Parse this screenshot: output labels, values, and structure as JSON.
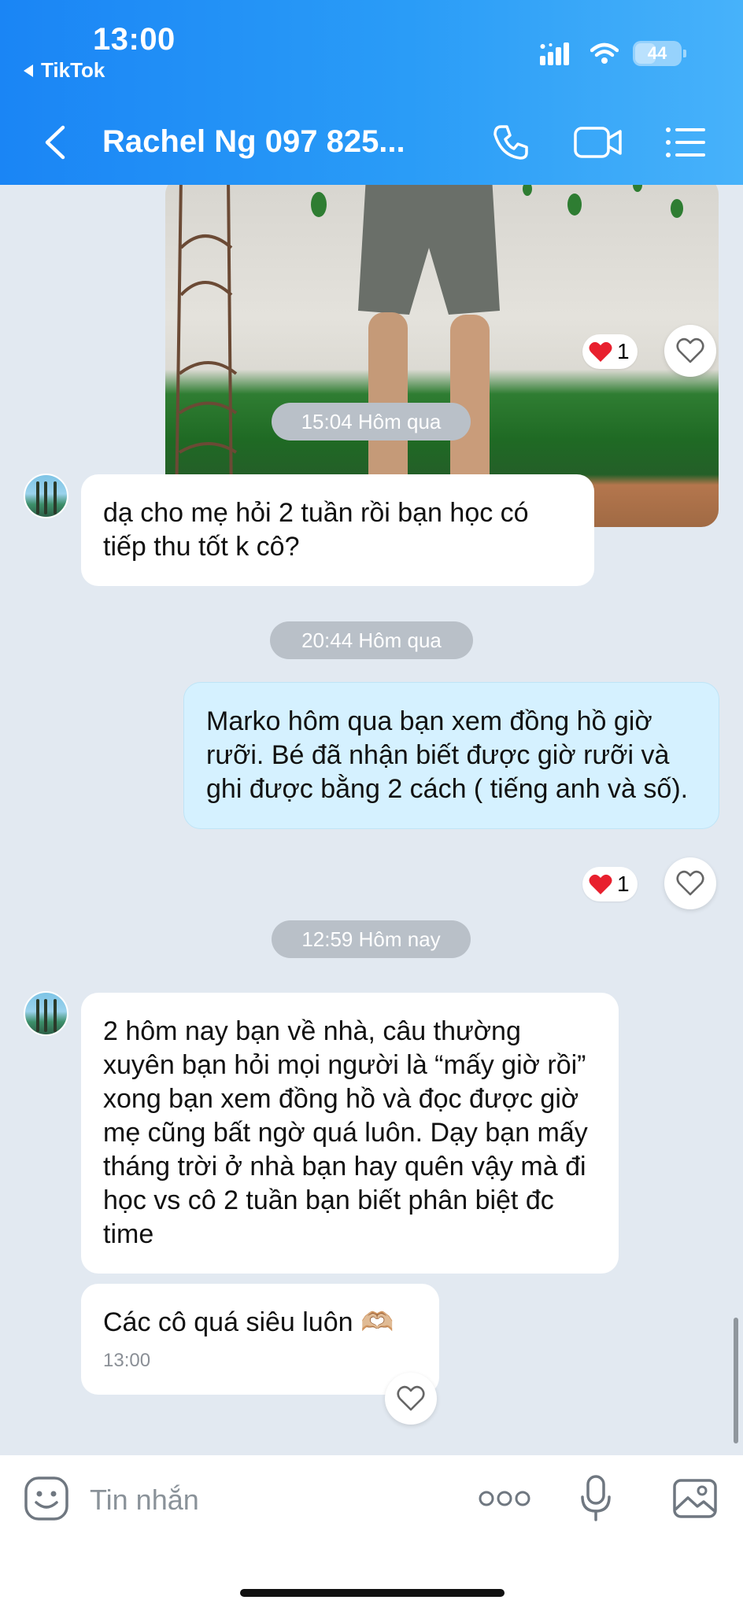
{
  "status_bar": {
    "time": "13:00",
    "back_app": "TikTok",
    "battery": "44"
  },
  "header": {
    "contact_name": "Rachel Ng 097 825..."
  },
  "messages": [
    {
      "type": "time",
      "text": "15:04 Hôm qua"
    },
    {
      "type": "incoming",
      "text": "dạ cho mẹ hỏi 2 tuần rồi bạn học có tiếp thu tốt k cô?"
    },
    {
      "type": "time",
      "text": "20:44 Hôm qua"
    },
    {
      "type": "outgoing",
      "text": "Marko hôm qua bạn xem đồng hồ giờ rưỡi. Bé đã nhận biết được giờ rưỡi và ghi được bằng 2 cách ( tiếng anh và số)."
    },
    {
      "type": "time",
      "text": "12:59 Hôm nay"
    },
    {
      "type": "incoming",
      "text": "2 hôm nay bạn về nhà, câu thường xuyên bạn hỏi mọi người là “mấy giờ rồi” xong bạn xem đồng hồ và đọc được giờ mẹ cũng bất ngờ quá luôn. Dạy bạn mấy tháng trời ở nhà bạn hay quên vậy mà đi học vs cô 2 tuần bạn biết phân biệt đc time"
    },
    {
      "type": "incoming",
      "text": "Các cô quá siêu luôn 🫶🏼",
      "time": "13:00"
    }
  ],
  "reactions": {
    "photo_count": "1",
    "outgoing_count": "1"
  },
  "input": {
    "placeholder": "Tin nhắn"
  },
  "colors": {
    "header_start": "#1a85f5",
    "header_end": "#47b2fa",
    "outgoing_bubble": "#d5f1ff",
    "chat_bg": "#e2e9f1",
    "heart": "#e8202e"
  }
}
